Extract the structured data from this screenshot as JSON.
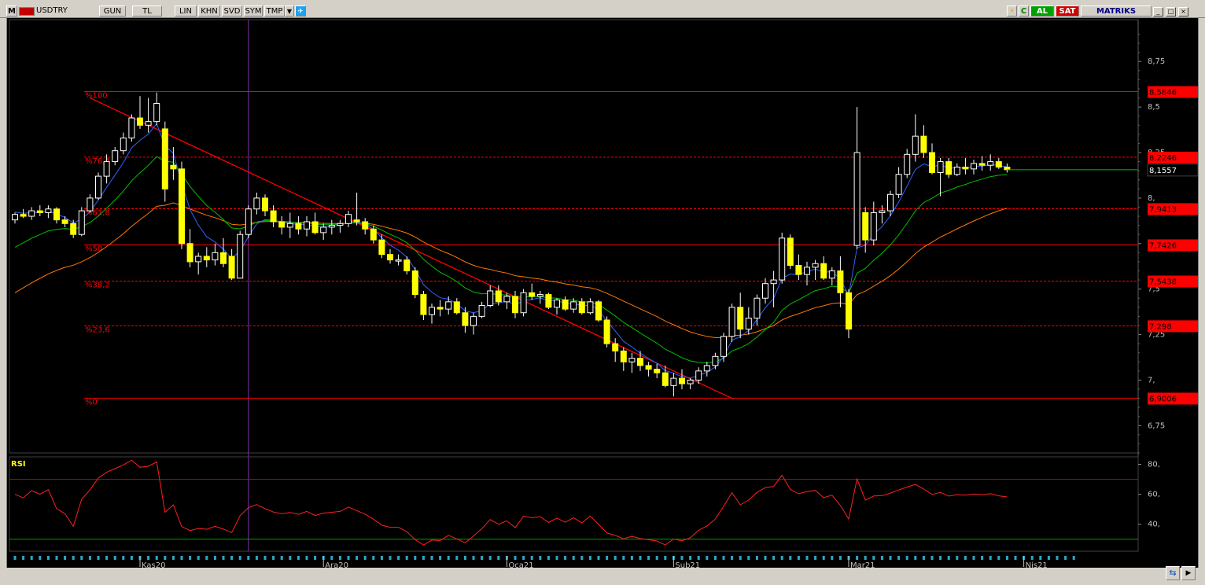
{
  "toolbar": {
    "logo": "M",
    "symbol": "USDTRY",
    "buttons": [
      "GUN",
      "TL",
      "LIN",
      "KHN",
      "SVD",
      "SYM",
      "TMP"
    ],
    "al_label": "AL",
    "sat_label": "SAT",
    "brand": "MATRIKS",
    "colors": {
      "al": "#00a000",
      "sat": "#d00000",
      "brand": "#000080"
    }
  },
  "chart_data": [
    {
      "type": "candlestick",
      "symbol": "USDTRY",
      "ylim": [
        6.6,
        8.98
      ],
      "y_ticks": [
        "8,75",
        "8,5",
        "8,25",
        "8,",
        "7,75",
        "7,5",
        "7,25",
        "7,",
        "6,75"
      ],
      "y_tick_values": [
        8.75,
        8.5,
        8.25,
        8.0,
        7.75,
        7.5,
        7.25,
        7.0,
        6.75
      ],
      "x_labels": [
        "Kas20",
        "Ara20",
        "Oca21",
        "Şub21",
        "Mar21",
        "Nis21"
      ],
      "x_label_index": [
        15,
        37,
        59,
        79,
        100,
        121
      ],
      "last_price": "8,1557",
      "last_value": 8.1557,
      "hidden_price_label": "8,2246",
      "fibonacci": {
        "levels": [
          {
            "label": "%100",
            "value": 8.5846,
            "price_label": "8,5846",
            "style": "solid"
          },
          {
            "label": "%76,4",
            "value": 8.2246,
            "price_label": "8,2246",
            "style": "dashed"
          },
          {
            "label": "%61,8",
            "value": 7.9413,
            "price_label": "7,9413",
            "style": "dashed"
          },
          {
            "label": "%50",
            "value": 7.7426,
            "price_label": "7,7426",
            "style": "solid"
          },
          {
            "label": "%38,2",
            "value": 7.5438,
            "price_label": "7,5438",
            "style": "dashed"
          },
          {
            "label": "%23,6",
            "value": 7.298,
            "price_label": "7,298",
            "style": "dashed"
          },
          {
            "label": "%0",
            "value": 6.9006,
            "price_label": "6,9006",
            "style": "solid"
          }
        ]
      },
      "trendline": {
        "from_index": 9,
        "from_value": 8.55,
        "to_index": 86,
        "to_value": 6.9
      },
      "cursor_index": 28,
      "colors": {
        "candle": "#ffff00",
        "wick": "#ffffff",
        "ma_fast": "#3060ff",
        "ma_mid": "#00c000",
        "ma_slow": "#ff7800",
        "fib": "#ff0000",
        "price_box": "#ff0000",
        "last_box": "#000000"
      },
      "candles": [
        [
          7.88,
          7.92,
          7.86,
          7.91
        ],
        [
          7.91,
          7.94,
          7.89,
          7.9
        ],
        [
          7.9,
          7.95,
          7.88,
          7.93
        ],
        [
          7.93,
          7.96,
          7.9,
          7.92
        ],
        [
          7.92,
          7.96,
          7.89,
          7.94
        ],
        [
          7.94,
          7.95,
          7.86,
          7.88
        ],
        [
          7.88,
          7.9,
          7.84,
          7.86
        ],
        [
          7.86,
          7.88,
          7.78,
          7.8
        ],
        [
          7.8,
          7.95,
          7.79,
          7.93
        ],
        [
          7.93,
          8.02,
          7.92,
          8.0
        ],
        [
          8.0,
          8.14,
          7.99,
          8.12
        ],
        [
          8.12,
          8.24,
          8.08,
          8.2
        ],
        [
          8.2,
          8.28,
          8.18,
          8.26
        ],
        [
          8.26,
          8.36,
          8.24,
          8.33
        ],
        [
          8.33,
          8.46,
          8.31,
          8.44
        ],
        [
          8.44,
          8.56,
          8.38,
          8.4
        ],
        [
          8.4,
          8.55,
          8.36,
          8.42
        ],
        [
          8.42,
          8.58,
          8.4,
          8.52
        ],
        [
          8.38,
          8.42,
          7.98,
          8.05
        ],
        [
          8.18,
          8.28,
          8.1,
          8.16
        ],
        [
          8.16,
          8.2,
          7.72,
          7.75
        ],
        [
          7.75,
          7.83,
          7.62,
          7.65
        ],
        [
          7.65,
          7.7,
          7.58,
          7.68
        ],
        [
          7.68,
          7.73,
          7.62,
          7.66
        ],
        [
          7.66,
          7.75,
          7.63,
          7.7
        ],
        [
          7.7,
          7.78,
          7.62,
          7.64
        ],
        [
          7.68,
          7.72,
          7.55,
          7.56
        ],
        [
          7.56,
          7.82,
          7.56,
          7.8
        ],
        [
          7.8,
          7.96,
          7.78,
          7.94
        ],
        [
          7.94,
          8.03,
          7.91,
          8.0
        ],
        [
          8.0,
          8.02,
          7.9,
          7.93
        ],
        [
          7.93,
          7.96,
          7.84,
          7.87
        ],
        [
          7.87,
          7.9,
          7.8,
          7.84
        ],
        [
          7.84,
          7.92,
          7.78,
          7.86
        ],
        [
          7.86,
          7.9,
          7.8,
          7.83
        ],
        [
          7.83,
          7.9,
          7.79,
          7.87
        ],
        [
          7.87,
          7.92,
          7.8,
          7.81
        ],
        [
          7.81,
          7.86,
          7.77,
          7.84
        ],
        [
          7.84,
          7.88,
          7.8,
          7.85
        ],
        [
          7.85,
          7.88,
          7.81,
          7.86
        ],
        [
          7.86,
          7.93,
          7.84,
          7.91
        ],
        [
          7.88,
          8.03,
          7.85,
          7.87
        ],
        [
          7.87,
          7.89,
          7.8,
          7.83
        ],
        [
          7.83,
          7.85,
          7.75,
          7.77
        ],
        [
          7.77,
          7.8,
          7.67,
          7.69
        ],
        [
          7.69,
          7.72,
          7.64,
          7.66
        ],
        [
          7.66,
          7.69,
          7.63,
          7.66
        ],
        [
          7.66,
          7.68,
          7.58,
          7.6
        ],
        [
          7.6,
          7.62,
          7.45,
          7.47
        ],
        [
          7.47,
          7.49,
          7.33,
          7.36
        ],
        [
          7.36,
          7.42,
          7.31,
          7.4
        ],
        [
          7.4,
          7.44,
          7.35,
          7.39
        ],
        [
          7.39,
          7.46,
          7.36,
          7.43
        ],
        [
          7.43,
          7.45,
          7.36,
          7.37
        ],
        [
          7.37,
          7.4,
          7.26,
          7.3
        ],
        [
          7.3,
          7.37,
          7.25,
          7.35
        ],
        [
          7.35,
          7.43,
          7.34,
          7.41
        ],
        [
          7.41,
          7.52,
          7.4,
          7.49
        ],
        [
          7.49,
          7.52,
          7.41,
          7.43
        ],
        [
          7.43,
          7.48,
          7.39,
          7.46
        ],
        [
          7.46,
          7.49,
          7.34,
          7.37
        ],
        [
          7.37,
          7.5,
          7.35,
          7.48
        ],
        [
          7.48,
          7.53,
          7.44,
          7.46
        ],
        [
          7.46,
          7.49,
          7.42,
          7.47
        ],
        [
          7.47,
          7.48,
          7.39,
          7.4
        ],
        [
          7.4,
          7.45,
          7.36,
          7.44
        ],
        [
          7.44,
          7.46,
          7.38,
          7.39
        ],
        [
          7.39,
          7.45,
          7.37,
          7.43
        ],
        [
          7.43,
          7.45,
          7.36,
          7.37
        ],
        [
          7.37,
          7.45,
          7.36,
          7.43
        ],
        [
          7.43,
          7.44,
          7.32,
          7.33
        ],
        [
          7.33,
          7.35,
          7.18,
          7.2
        ],
        [
          7.2,
          7.23,
          7.1,
          7.16
        ],
        [
          7.16,
          7.18,
          7.05,
          7.1
        ],
        [
          7.1,
          7.15,
          7.04,
          7.12
        ],
        [
          7.12,
          7.16,
          7.05,
          7.08
        ],
        [
          7.08,
          7.1,
          7.02,
          7.06
        ],
        [
          7.06,
          7.09,
          7.01,
          7.04
        ],
        [
          7.04,
          7.08,
          6.96,
          6.97
        ],
        [
          6.97,
          7.04,
          6.91,
          7.01
        ],
        [
          7.01,
          7.06,
          6.95,
          6.98
        ],
        [
          6.98,
          7.01,
          6.95,
          7.0
        ],
        [
          7.0,
          7.07,
          6.98,
          7.05
        ],
        [
          7.05,
          7.1,
          7.02,
          7.08
        ],
        [
          7.08,
          7.15,
          7.06,
          7.13
        ],
        [
          7.13,
          7.26,
          7.1,
          7.24
        ],
        [
          7.24,
          7.42,
          7.21,
          7.4
        ],
        [
          7.4,
          7.48,
          7.23,
          7.28
        ],
        [
          7.28,
          7.4,
          7.25,
          7.34
        ],
        [
          7.34,
          7.47,
          7.3,
          7.45
        ],
        [
          7.45,
          7.56,
          7.42,
          7.53
        ],
        [
          7.53,
          7.6,
          7.4,
          7.55
        ],
        [
          7.55,
          7.81,
          7.53,
          7.78
        ],
        [
          7.78,
          7.8,
          7.61,
          7.63
        ],
        [
          7.63,
          7.69,
          7.55,
          7.58
        ],
        [
          7.58,
          7.65,
          7.52,
          7.62
        ],
        [
          7.62,
          7.66,
          7.55,
          7.64
        ],
        [
          7.64,
          7.68,
          7.55,
          7.56
        ],
        [
          7.56,
          7.62,
          7.52,
          7.6
        ],
        [
          7.6,
          7.68,
          7.4,
          7.48
        ],
        [
          7.48,
          7.5,
          7.23,
          7.28
        ],
        [
          7.74,
          8.5,
          7.72,
          8.25
        ],
        [
          7.92,
          7.95,
          7.7,
          7.77
        ],
        [
          7.77,
          7.98,
          7.74,
          7.92
        ],
        [
          7.92,
          7.96,
          7.86,
          7.93
        ],
        [
          7.93,
          8.04,
          7.9,
          8.02
        ],
        [
          8.02,
          8.17,
          8.0,
          8.13
        ],
        [
          8.13,
          8.27,
          8.11,
          8.24
        ],
        [
          8.24,
          8.46,
          8.2,
          8.34
        ],
        [
          8.34,
          8.4,
          8.22,
          8.25
        ],
        [
          8.25,
          8.3,
          8.13,
          8.14
        ],
        [
          8.14,
          8.22,
          8.01,
          8.2
        ],
        [
          8.2,
          8.22,
          8.11,
          8.13
        ],
        [
          8.13,
          8.19,
          8.12,
          8.17
        ],
        [
          8.17,
          8.22,
          8.13,
          8.16
        ],
        [
          8.16,
          8.21,
          8.13,
          8.19
        ],
        [
          8.19,
          8.23,
          8.15,
          8.18
        ],
        [
          8.18,
          8.24,
          8.15,
          8.2
        ],
        [
          8.2,
          8.22,
          8.16,
          8.17
        ],
        [
          8.17,
          8.19,
          8.14,
          8.1557
        ]
      ]
    },
    {
      "type": "line",
      "title": "RSI",
      "ylim": [
        22,
        85
      ],
      "y_ticks": [
        "80,",
        "60,",
        "40,"
      ],
      "y_tick_values": [
        80,
        60,
        40
      ],
      "levels": [
        70,
        30
      ],
      "colors": {
        "line": "#ff2020",
        "upper": "#d00000",
        "lower": "#00a000"
      }
    }
  ]
}
